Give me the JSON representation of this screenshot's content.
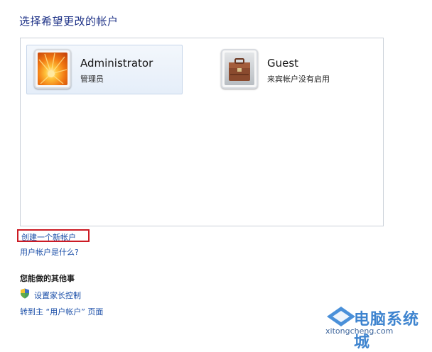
{
  "page": {
    "title": "选择希望更改的帐户"
  },
  "accounts": [
    {
      "name": "Administrator",
      "subtitle": "管理员",
      "avatar": "flower-avatar"
    },
    {
      "name": "Guest",
      "subtitle": "来宾帐户没有启用",
      "avatar": "briefcase-avatar"
    }
  ],
  "links": {
    "create_account": "创建一个新帐户",
    "what_is_account": "用户帐户是什么?"
  },
  "other_tasks": {
    "heading": "您能做的其他事",
    "parental_controls": "设置家长控制",
    "goto_main": "转到主 “用户帐户” 页面"
  },
  "watermark": {
    "logo_text": "电脑系统城",
    "url": "xitongcheng.com"
  },
  "colors": {
    "title": "#1e3287",
    "link": "#1a4ea8",
    "highlight_border": "#cc1b24"
  }
}
